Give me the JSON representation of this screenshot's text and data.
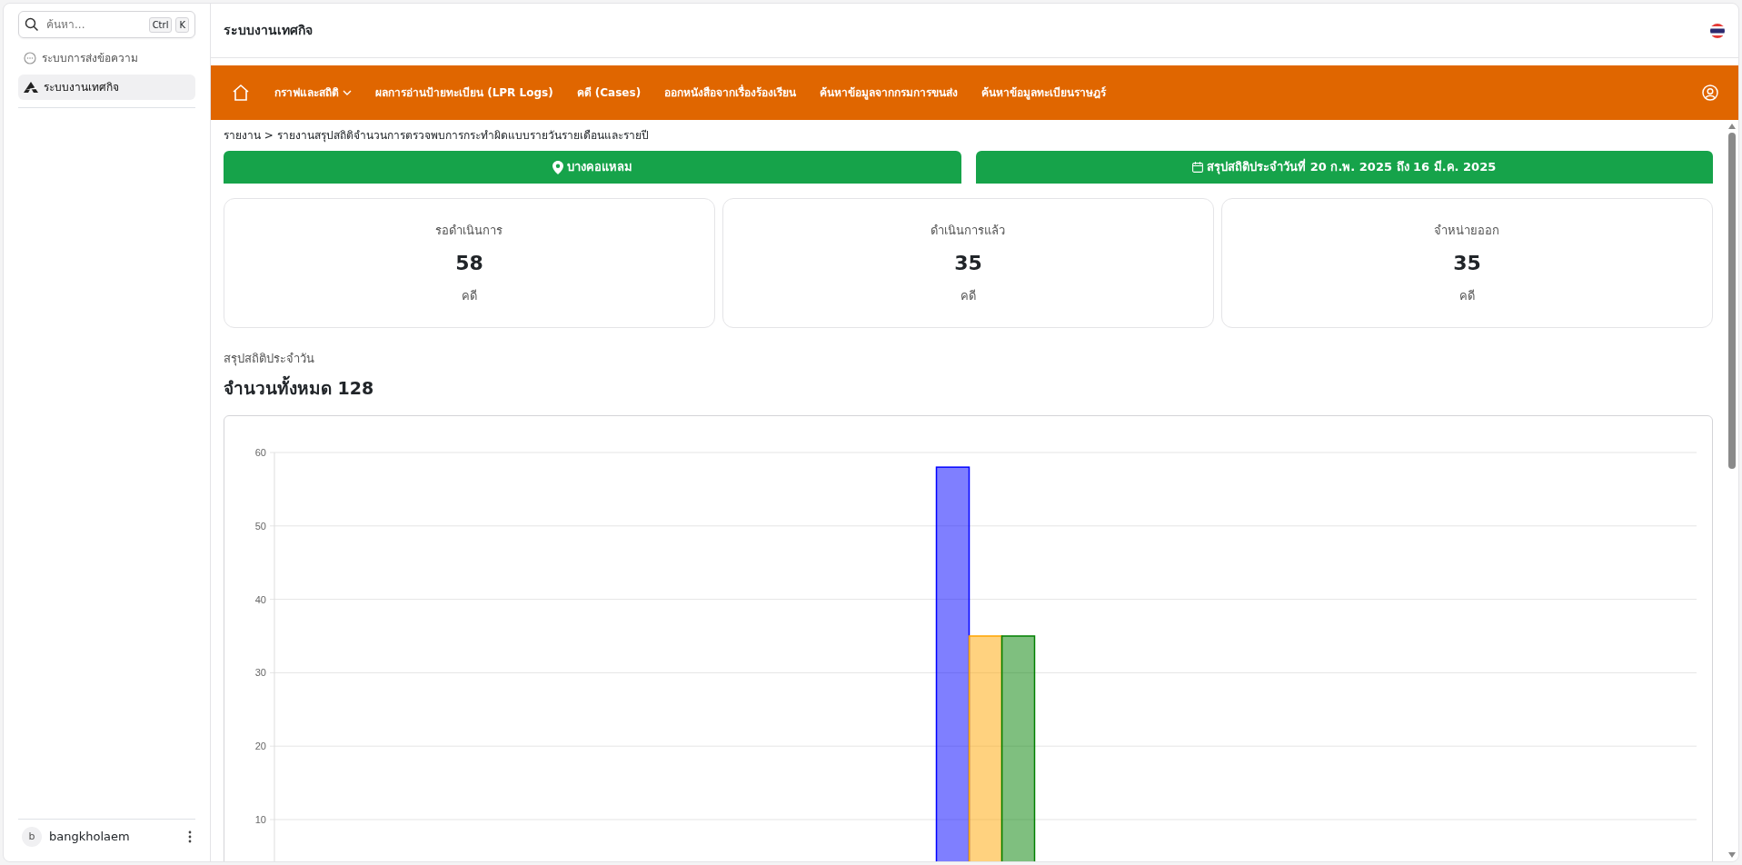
{
  "sidebar": {
    "search": {
      "placeholder": "ค้นหา...",
      "shortcut": [
        "Ctrl",
        "K"
      ]
    },
    "items": [
      {
        "label": "ระบบการส่งข้อความ",
        "kind": "chat",
        "selected": false
      },
      {
        "label": "ระบบงานเทศกิจ",
        "kind": "logo",
        "selected": true
      }
    ],
    "user": {
      "initial": "b",
      "name": "bangkholaem"
    }
  },
  "header": {
    "title": "ระบบงานเทศกิจ"
  },
  "navbar": {
    "items": [
      {
        "label": "กราฟและสถิติ",
        "dropdown": true
      },
      {
        "label": "ผลการอ่านป้ายทะเบียน (LPR Logs)",
        "dropdown": false
      },
      {
        "label": "คดี (Cases)",
        "dropdown": false
      },
      {
        "label": "ออกหนังสือจากเรื่องร้องเรียน",
        "dropdown": false
      },
      {
        "label": "ค้นหาข้อมูลจากกรมการขนส่ง",
        "dropdown": false
      },
      {
        "label": "ค้นหาข้อมูลทะเบียนราษฎร์",
        "dropdown": false
      }
    ]
  },
  "breadcrumb": "รายงาน > รายงานสรุปสถิติจำนวนการตรวจพบการกระทำผิดแบบรายวันรายเดือนและรายปี",
  "banners": [
    {
      "kind": "location",
      "text": "บางคอแหลม"
    },
    {
      "kind": "date",
      "text": "สรุปสถิติประจำวันที่ 20 ก.พ. 2025 ถึง 16 มี.ค. 2025"
    }
  ],
  "stats": [
    {
      "label": "รอดำเนินการ",
      "value": "58",
      "unit": "คดี"
    },
    {
      "label": "ดำเนินการแล้ว",
      "value": "35",
      "unit": "คดี"
    },
    {
      "label": "จำหน่ายออก",
      "value": "35",
      "unit": "คดี"
    }
  ],
  "section": {
    "subtitle": "สรุปสถิติประจำวัน",
    "title": "จำนวนทั้งหมด 128",
    "chart_data": {
      "type": "bar",
      "ylim": [
        0,
        60
      ],
      "grid": true,
      "yticks": [
        10,
        20,
        30,
        40,
        50,
        60
      ],
      "series": [
        {
          "color": "#0000ff",
          "values": [
            58
          ]
        },
        {
          "color": "#ffa500",
          "values": [
            35
          ]
        },
        {
          "color": "#008000",
          "values": [
            35
          ]
        }
      ]
    }
  }
}
